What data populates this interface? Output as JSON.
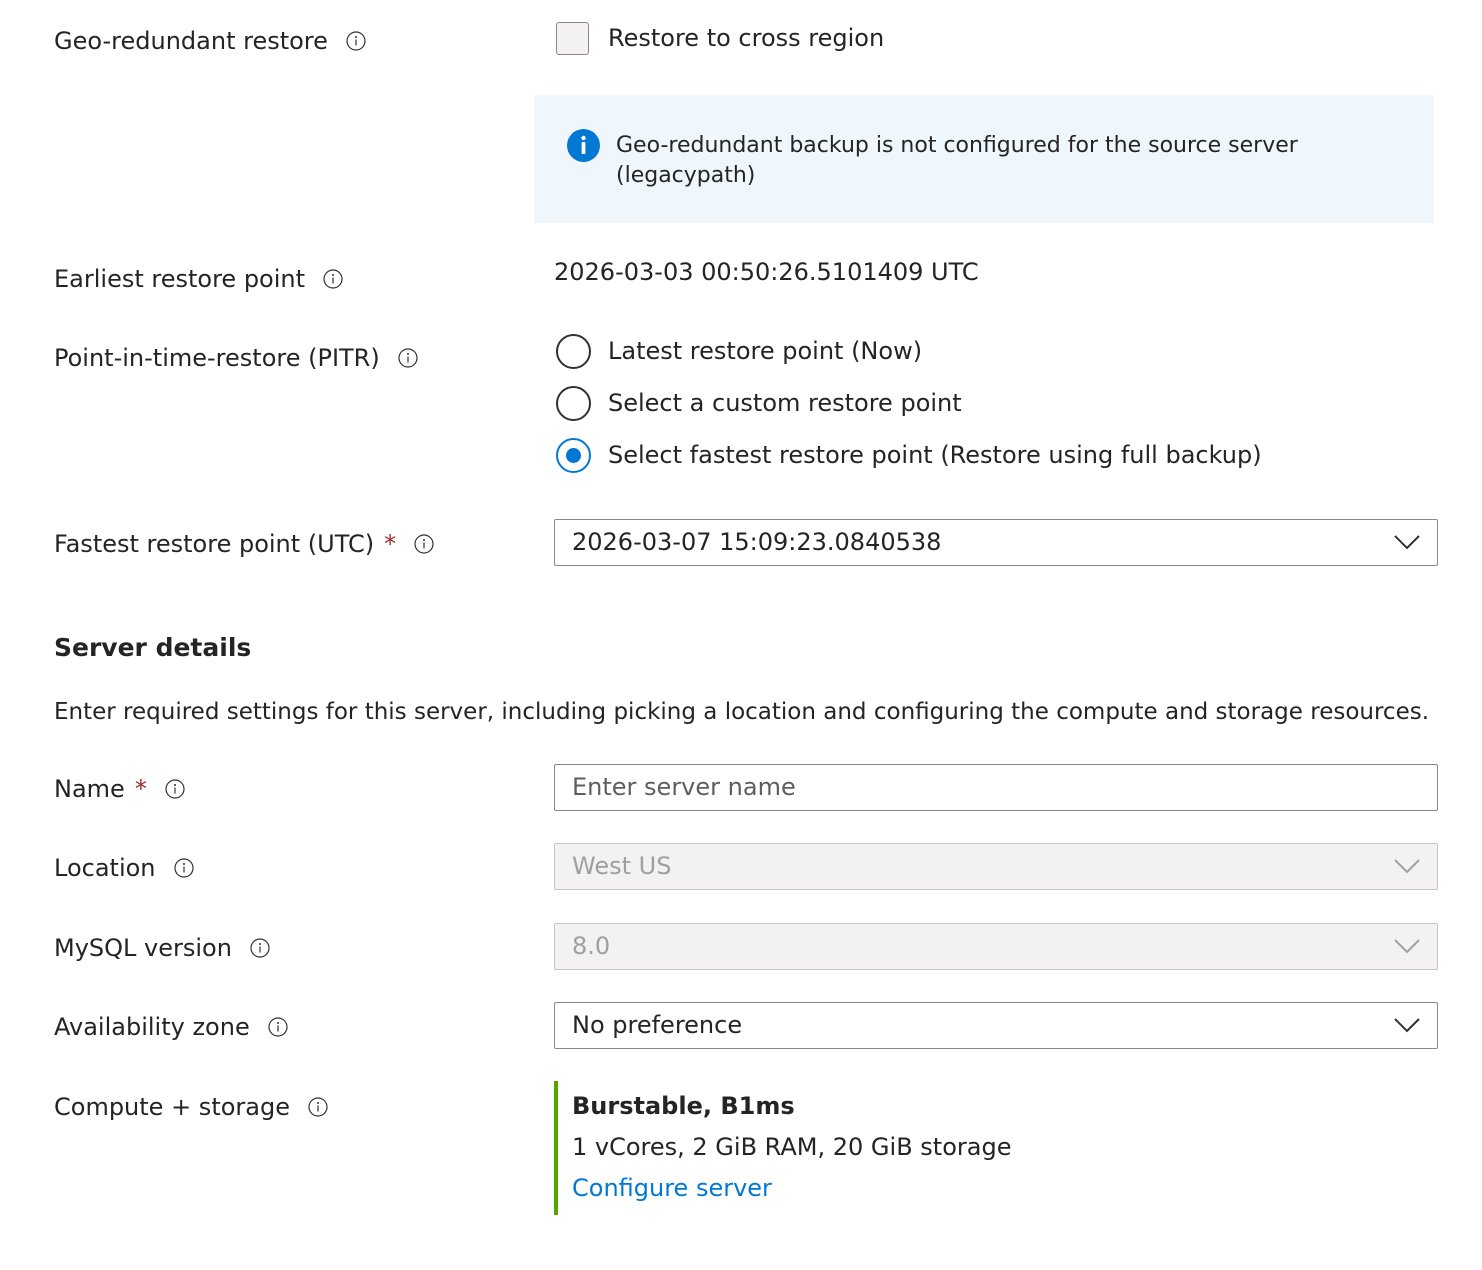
{
  "geo_restore": {
    "label": "Geo-redundant restore",
    "checkbox_label": "Restore to cross region",
    "checked": false
  },
  "info_message": {
    "text": "Geo-redundant backup is not configured for the source server (legacypath)"
  },
  "earliest_restore": {
    "label": "Earliest restore point",
    "value": "2026-03-03 00:50:26.5101409 UTC"
  },
  "pitr": {
    "label": "Point-in-time-restore (PITR)",
    "options": [
      {
        "label": "Latest restore point (Now)",
        "selected": false
      },
      {
        "label": "Select a custom restore point",
        "selected": false
      },
      {
        "label": "Select fastest restore point (Restore using full backup)",
        "selected": true
      }
    ]
  },
  "fastest_restore": {
    "label": "Fastest restore point (UTC)",
    "required_mark": "*",
    "value": "2026-03-07 15:09:23.0840538"
  },
  "server_details": {
    "title": "Server details",
    "description": "Enter required settings for this server, including picking a location and configuring the compute and storage resources."
  },
  "name": {
    "label": "Name",
    "required_mark": "*",
    "placeholder": "Enter server name",
    "value": ""
  },
  "location": {
    "label": "Location",
    "value": "West US",
    "disabled": true
  },
  "mysql_version": {
    "label": "MySQL version",
    "value": "8.0",
    "disabled": true
  },
  "availability_zone": {
    "label": "Availability zone",
    "value": "No preference"
  },
  "compute_storage": {
    "label": "Compute + storage",
    "tier": "Burstable, B1ms",
    "specs": "1 vCores, 2 GiB RAM, 20 GiB storage",
    "link": "Configure server"
  },
  "colors": {
    "accent": "#0078d4",
    "required": "#a4262c",
    "compute_bar": "#57a300",
    "info_bg": "#eff6fc"
  }
}
